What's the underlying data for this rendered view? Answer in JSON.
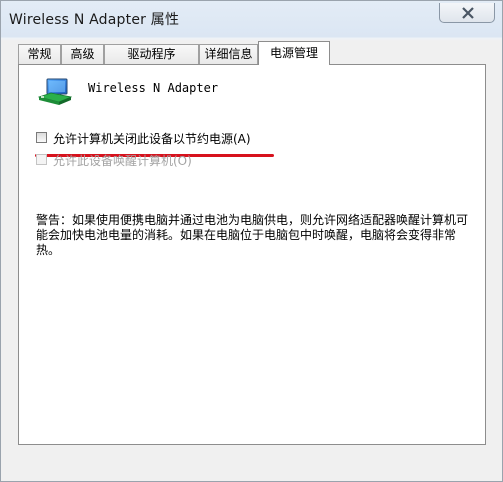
{
  "window": {
    "title": "Wireless N Adapter 属性"
  },
  "tabs": [
    {
      "label": "常规",
      "active": false
    },
    {
      "label": "高级",
      "active": false
    },
    {
      "label": "驱动程序",
      "active": false
    },
    {
      "label": "详细信息",
      "active": false
    },
    {
      "label": "电源管理",
      "active": true
    }
  ],
  "device": {
    "name": "Wireless N Adapter",
    "icon": "network-adapter-icon"
  },
  "options": [
    {
      "label": "允许计算机关闭此设备以节约电源(A)",
      "checked": false,
      "enabled": true
    },
    {
      "label": "允许此设备唤醒计算机(O)",
      "checked": false,
      "enabled": false
    }
  ],
  "warning_text": "警告：如果使用便携电脑并通过电池为电脑供电，则允许网络适配器唤醒计算机可能会加快电池电量的消耗。如果在电脑位于电脑包中时唤醒，电脑将会变得非常热。",
  "colors": {
    "highlight_underline": "#d7121d"
  }
}
